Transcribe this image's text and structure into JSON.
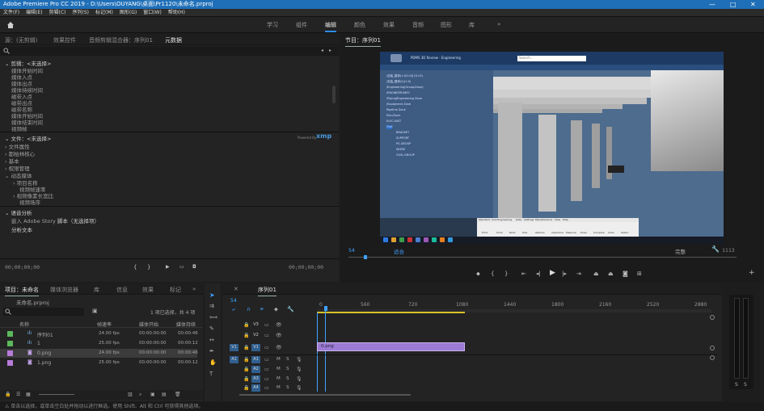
{
  "title_bar": {
    "title": "Adobe Premiere Pro CC 2019 - D:\\Users\\OUYANG\\桌面\\Pr1120\\未命名.prproj",
    "minimize": "—",
    "maximize": "□",
    "close": "✕"
  },
  "menu": [
    "文件(F)",
    "编辑(E)",
    "剪辑(C)",
    "序列(S)",
    "标记(M)",
    "图形(G)",
    "窗口(W)",
    "帮助(H)"
  ],
  "workspaces": {
    "home_icon": "home-icon",
    "tabs": [
      "学习",
      "组件",
      "编辑",
      "颜色",
      "效果",
      "音频",
      "图形",
      "库"
    ],
    "active_index": 2,
    "more": "»"
  },
  "metadata_panel": {
    "tabs": [
      "源：(无剪辑)",
      "效果控件",
      "音频剪辑混合器：序列01",
      "元数据"
    ],
    "active_tab": 3,
    "clip_header": "剪辑：<未选择>",
    "clip_rows": [
      "媒体开始时间",
      "媒体入点",
      "媒体出点",
      "媒体持续时间",
      "磁带入点",
      "磁带出点",
      "磁带名称",
      "媒体开始时间",
      "媒体结束时间",
      "视频帧"
    ],
    "file_header": "文件：<未选择>",
    "powered_by": "Powered By",
    "xmp": "xmp",
    "file_rows": [
      "文件属性",
      "都柏林核心",
      "基本",
      "权限管理",
      "动态媒体"
    ],
    "sub_rows": [
      "项目名称",
      "视频帧速率",
      "视频像素长宽比",
      "视频场序"
    ],
    "speech_header": "语音分析",
    "speech_row_prefix": "嵌入 Adobe Story",
    "speech_row_value": "脚本（无选择项）",
    "analysis": "分析文本",
    "tc_left": "00;00;00;00",
    "tc_right": "00;00;00;00"
  },
  "program_monitor": {
    "tab": "节目：序列01",
    "timecode": "54",
    "fit_label": "适合",
    "quality_label": "完整",
    "duration": "1113",
    "app_window": {
      "title_bar": "PDMS 3D Review - Engineering",
      "search_placeholder": "Search...",
      "tree": [
        "/总装_整体(1:0/1:0)(10-V2)",
        "/总装_整体(2)(1:0)",
        "/Engineering(Group/Zone)",
        "/ENGINEER-INFO",
        "/Piping/Engineering Zone",
        "/Equipment Zone",
        "Pipeline Zone",
        "Elec/Zone",
        "ELEC-INST",
        "Civil",
        "BRACKET",
        "SUPPORT",
        "PS-GROUP",
        "WORK",
        "CIVIL-GROUP"
      ],
      "ribbon_tabs": [
        "Standard",
        "Civil Engineering",
        "Data",
        "Settings",
        "Miscellaneous",
        "View",
        "Help"
      ],
      "tool_labels": [
        "Print",
        "Undo",
        "Redo",
        "Tree",
        "Options",
        "Clearance",
        "Measure",
        "Draw",
        "Compare",
        "Links",
        "Select"
      ]
    },
    "controls": [
      "marker-icon",
      "in-point-icon",
      "out-point-icon",
      "go-to-in-icon",
      "step-back-icon",
      "play-icon",
      "step-forward-icon",
      "go-to-out-icon",
      "lift-icon",
      "extract-icon",
      "export-frame-icon",
      "button-editor-icon",
      "add-icon"
    ]
  },
  "project_panel": {
    "tabs": [
      "项目：未命名",
      "媒体浏览器",
      "库",
      "信息",
      "效果",
      "标记",
      "历史记录"
    ],
    "active_tab": 0,
    "file": "未命名.prproj",
    "search_placeholder": "",
    "selection_info": "1 项已选择，共 4 项",
    "columns": [
      "名称",
      "帧速率",
      "媒体开始",
      "媒体持续"
    ],
    "items": [
      {
        "name": "序列01",
        "color": "#5cb85c",
        "fps": "24.00 fps",
        "start": "00:00:00:00",
        "dur": "00:00:46"
      },
      {
        "name": "1",
        "color": "#5cb85c",
        "fps": "25.00 fps",
        "start": "00:00:00:00",
        "dur": "00:00:12"
      },
      {
        "name": "0.png",
        "color": "#b77bd9",
        "fps": "24.00 fps",
        "start": "00:00:00:00",
        "dur": "00:00:46"
      },
      {
        "name": "1.png",
        "color": "#b77bd9",
        "fps": "25.00 fps",
        "start": "00:00:00:00",
        "dur": "00:00:12"
      }
    ]
  },
  "timeline": {
    "tab": "序列01",
    "timecode": "54",
    "ruler": [
      "0",
      "560",
      "720",
      "1080",
      "1440",
      "1800",
      "2160",
      "2520",
      "2880"
    ],
    "video_tracks": [
      "V3",
      "V2",
      "V1"
    ],
    "audio_tracks": [
      "A1",
      "A2",
      "A3",
      "A4"
    ],
    "source_v": "V1",
    "source_a": "A1",
    "clip_name": "0.png",
    "clip_color": "#9b7bd3",
    "mute": "M",
    "solo": "S"
  },
  "audio_meter": {
    "labels": [
      "S",
      "S"
    ]
  },
  "status_bar": "单击以选择，或单击空白处并拖动以进行框选。使用 Shift、Alt 和 Ctrl 可获得其他选项。"
}
